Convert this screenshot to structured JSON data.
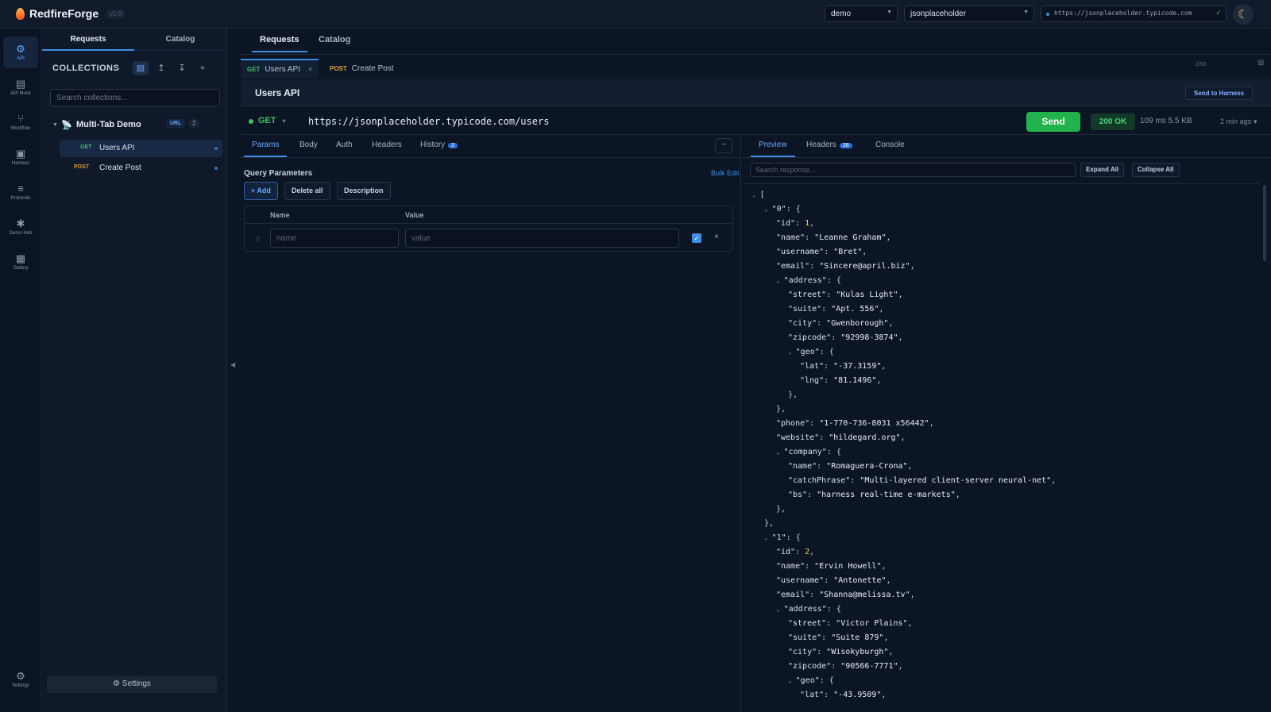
{
  "app": {
    "name": "RedfireForge",
    "version": "v1.0"
  },
  "topbar": {
    "environment": "demo",
    "api_source": "jsonplaceholder",
    "base_url": "https://jsonplaceholder.typicode.com",
    "theme_icon": "moon-icon"
  },
  "rail": [
    {
      "label": "API",
      "icon": "api-icon",
      "glyph": "⚙"
    },
    {
      "label": "API Mock",
      "icon": "api-mock-icon",
      "glyph": "▤"
    },
    {
      "label": "Workflow",
      "icon": "workflow-icon",
      "glyph": "⑂"
    },
    {
      "label": "Harness",
      "icon": "harness-icon",
      "glyph": "▣"
    },
    {
      "label": "Protocols",
      "icon": "protocols-icon",
      "glyph": "≡"
    },
    {
      "label": "Demo Hub",
      "icon": "demo-hub-icon",
      "glyph": "✱"
    },
    {
      "label": "Gallery",
      "icon": "gallery-icon",
      "glyph": "▦"
    },
    {
      "label": "Settings",
      "icon": "gear-icon",
      "glyph": "⚙"
    }
  ],
  "sidebar": {
    "tabs": [
      "Requests",
      "Catalog"
    ],
    "collections_title": "COLLECTIONS",
    "search_placeholder": "Search collections...",
    "collection": {
      "name": "Multi-Tab Demo",
      "badge": "URL",
      "count": "2"
    },
    "requests": [
      {
        "method": "GET",
        "name": "Users API"
      },
      {
        "method": "POST",
        "name": "Create Post"
      }
    ],
    "settings_label": "⚙ Settings"
  },
  "main": {
    "tabs": [
      "Requests",
      "Catalog"
    ],
    "request_tabs": [
      {
        "method": "GET",
        "name": "Users API"
      },
      {
        "method": "POST",
        "name": "Create Post"
      }
    ],
    "tab_count": "2/50",
    "request_title": "Users API",
    "send_to_harness": "Send to Harness",
    "method": "GET",
    "url": "https://jsonplaceholder.typicode.com/users",
    "send_label": "Send",
    "status": "200 OK",
    "timing": "109 ms  5.5 KB",
    "time_ago": "2 min ago"
  },
  "request_pane": {
    "tabs": [
      "Params",
      "Body",
      "Auth",
      "Headers",
      "History"
    ],
    "history_count": "2",
    "query_title": "Query Parameters",
    "bulk_edit": "Bulk Edit",
    "add_label": "+ Add",
    "delete_all_label": "Delete all",
    "description_label": "Description",
    "col_name": "Name",
    "col_value": "Value",
    "name_placeholder": "name",
    "value_placeholder": "value"
  },
  "response_pane": {
    "tabs": [
      "Preview",
      "Headers",
      "Console"
    ],
    "headers_count": "26",
    "search_placeholder": "Search response...",
    "expand_all": "Expand All",
    "collapse_all": "Collapse All",
    "json_lines": [
      {
        "d": 0,
        "t": "[",
        "tog": true
      },
      {
        "d": 1,
        "k": "\"0\"",
        "t": ": {",
        "tog": true
      },
      {
        "d": 2,
        "k": "\"id\"",
        "t": ": ",
        "n": "1",
        "e": ","
      },
      {
        "d": 2,
        "k": "\"name\"",
        "t": ": ",
        "s": "\"Leanne Graham\"",
        "e": ","
      },
      {
        "d": 2,
        "k": "\"username\"",
        "t": ": ",
        "s": "\"Bret\"",
        "e": ","
      },
      {
        "d": 2,
        "k": "\"email\"",
        "t": ": ",
        "s": "\"Sincere@april.biz\"",
        "e": ","
      },
      {
        "d": 2,
        "k": "\"address\"",
        "t": ": {",
        "tog": true
      },
      {
        "d": 3,
        "k": "\"street\"",
        "t": ": ",
        "s": "\"Kulas Light\"",
        "e": ","
      },
      {
        "d": 3,
        "k": "\"suite\"",
        "t": ": ",
        "s": "\"Apt. 556\"",
        "e": ","
      },
      {
        "d": 3,
        "k": "\"city\"",
        "t": ": ",
        "s": "\"Gwenborough\"",
        "e": ","
      },
      {
        "d": 3,
        "k": "\"zipcode\"",
        "t": ": ",
        "s": "\"92998-3874\"",
        "e": ","
      },
      {
        "d": 3,
        "k": "\"geo\"",
        "t": ": {",
        "tog": true
      },
      {
        "d": 4,
        "k": "\"lat\"",
        "t": ": ",
        "s": "\"-37.3159\"",
        "e": ","
      },
      {
        "d": 4,
        "k": "\"lng\"",
        "t": ": ",
        "s": "\"81.1496\"",
        "e": ","
      },
      {
        "d": 3,
        "t": "},"
      },
      {
        "d": 2,
        "t": "},"
      },
      {
        "d": 2,
        "k": "\"phone\"",
        "t": ": ",
        "s": "\"1-770-736-8031 x56442\"",
        "e": ","
      },
      {
        "d": 2,
        "k": "\"website\"",
        "t": ": ",
        "s": "\"hildegard.org\"",
        "e": ","
      },
      {
        "d": 2,
        "k": "\"company\"",
        "t": ": {",
        "tog": true
      },
      {
        "d": 3,
        "k": "\"name\"",
        "t": ": ",
        "s": "\"Romaguera-Crona\"",
        "e": ","
      },
      {
        "d": 3,
        "k": "\"catchPhrase\"",
        "t": ": ",
        "s": "\"Multi-layered client-server neural-net\"",
        "e": ","
      },
      {
        "d": 3,
        "k": "\"bs\"",
        "t": ": ",
        "s": "\"harness real-time e-markets\"",
        "e": ","
      },
      {
        "d": 2,
        "t": "},"
      },
      {
        "d": 1,
        "t": "},"
      },
      {
        "d": 1,
        "k": "\"1\"",
        "t": ": {",
        "tog": true
      },
      {
        "d": 2,
        "k": "\"id\"",
        "t": ": ",
        "n": "2",
        "e": ","
      },
      {
        "d": 2,
        "k": "\"name\"",
        "t": ": ",
        "s": "\"Ervin Howell\"",
        "e": ","
      },
      {
        "d": 2,
        "k": "\"username\"",
        "t": ": ",
        "s": "\"Antonette\"",
        "e": ","
      },
      {
        "d": 2,
        "k": "\"email\"",
        "t": ": ",
        "s": "\"Shanna@melissa.tv\"",
        "e": ","
      },
      {
        "d": 2,
        "k": "\"address\"",
        "t": ": {",
        "tog": true
      },
      {
        "d": 3,
        "k": "\"street\"",
        "t": ": ",
        "s": "\"Victor Plains\"",
        "e": ","
      },
      {
        "d": 3,
        "k": "\"suite\"",
        "t": ": ",
        "s": "\"Suite 879\"",
        "e": ","
      },
      {
        "d": 3,
        "k": "\"city\"",
        "t": ": ",
        "s": "\"Wisokyburgh\"",
        "e": ","
      },
      {
        "d": 3,
        "k": "\"zipcode\"",
        "t": ": ",
        "s": "\"90566-7771\"",
        "e": ","
      },
      {
        "d": 3,
        "k": "\"geo\"",
        "t": ": {",
        "tog": true
      },
      {
        "d": 4,
        "k": "\"lat\"",
        "t": ": ",
        "s": "\"-43.9509\"",
        "e": ","
      }
    ]
  },
  "colors": {
    "get": "#3fbf5f",
    "post": "#e0a030",
    "accent": "#3a8ee6",
    "send": "#22b24c"
  }
}
